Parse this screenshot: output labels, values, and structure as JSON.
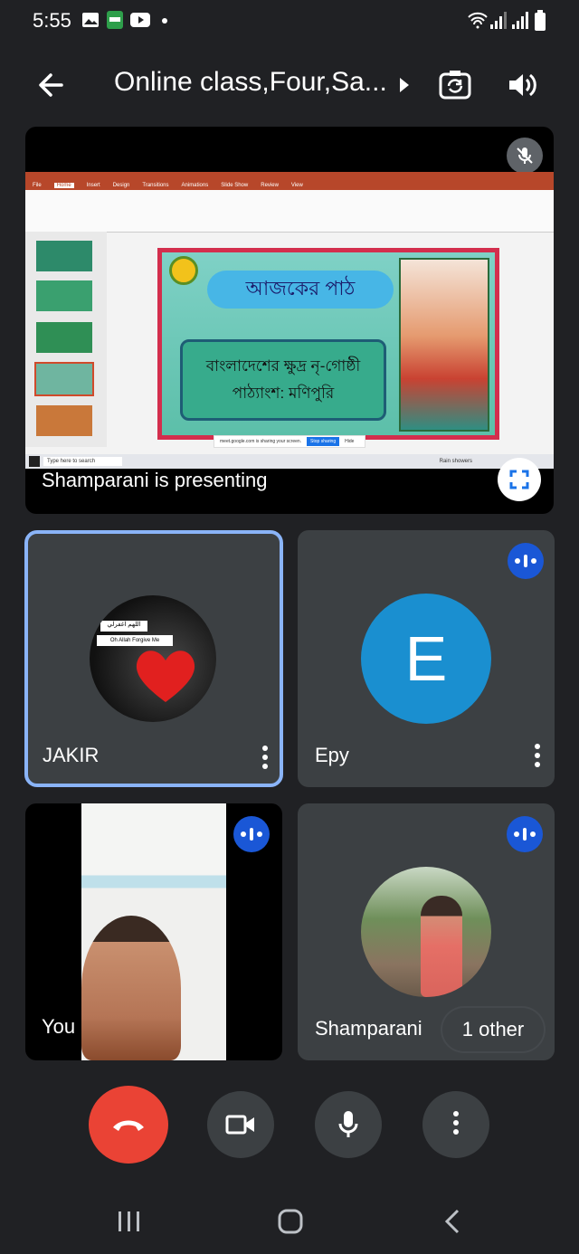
{
  "status_bar": {
    "time": "5:55",
    "icons": [
      "gallery-icon",
      "app-icon",
      "youtube-icon",
      "dot-icon",
      "wifi-icon",
      "signal-icon",
      "signal-icon",
      "battery-icon"
    ]
  },
  "app_bar": {
    "title": "Online class,Four,Sa...",
    "icons": [
      "back-arrow-icon",
      "chevron-right-icon",
      "switch-camera-icon",
      "speaker-icon"
    ]
  },
  "presentation": {
    "caption": "Shamparani is presenting",
    "slide_title": "আজকের পাঠ",
    "slide_line1": "বাংলাদেশের ক্ষুদ্র নৃ-গোষ্ঠী",
    "slide_line2": "পাঠ্যাংশ: মণিপুরি",
    "taskbar_search": "Type here to search",
    "sharing_notice": "meet.google.com is sharing your screen.",
    "stop_sharing": "Stop sharing",
    "hide": "Hide",
    "weather": "Rain showers",
    "ribbon_tabs": [
      "File",
      "Home",
      "Insert",
      "Design",
      "Transitions",
      "Animations",
      "Slide Show",
      "Review",
      "View"
    ]
  },
  "participants": [
    {
      "name": "JAKIR",
      "avatar_text": "اللهم اغفرلي",
      "avatar_sub": "Oh Allah Forgive Me"
    },
    {
      "name": "Epy",
      "initial": "E",
      "avatar_color": "#1a8fd0"
    },
    {
      "name": "You"
    },
    {
      "name": "Shamparani",
      "others_label": "1 other"
    }
  ],
  "colors": {
    "background": "#202124",
    "tile": "#3c4043",
    "end_call": "#ea4335",
    "accent": "#1a57d6",
    "selected_border": "#8ab4f8"
  },
  "controls": [
    "end-call-button",
    "camera-button",
    "microphone-button",
    "more-options-button"
  ],
  "nav": [
    "recent-apps-icon",
    "home-icon",
    "back-icon"
  ]
}
